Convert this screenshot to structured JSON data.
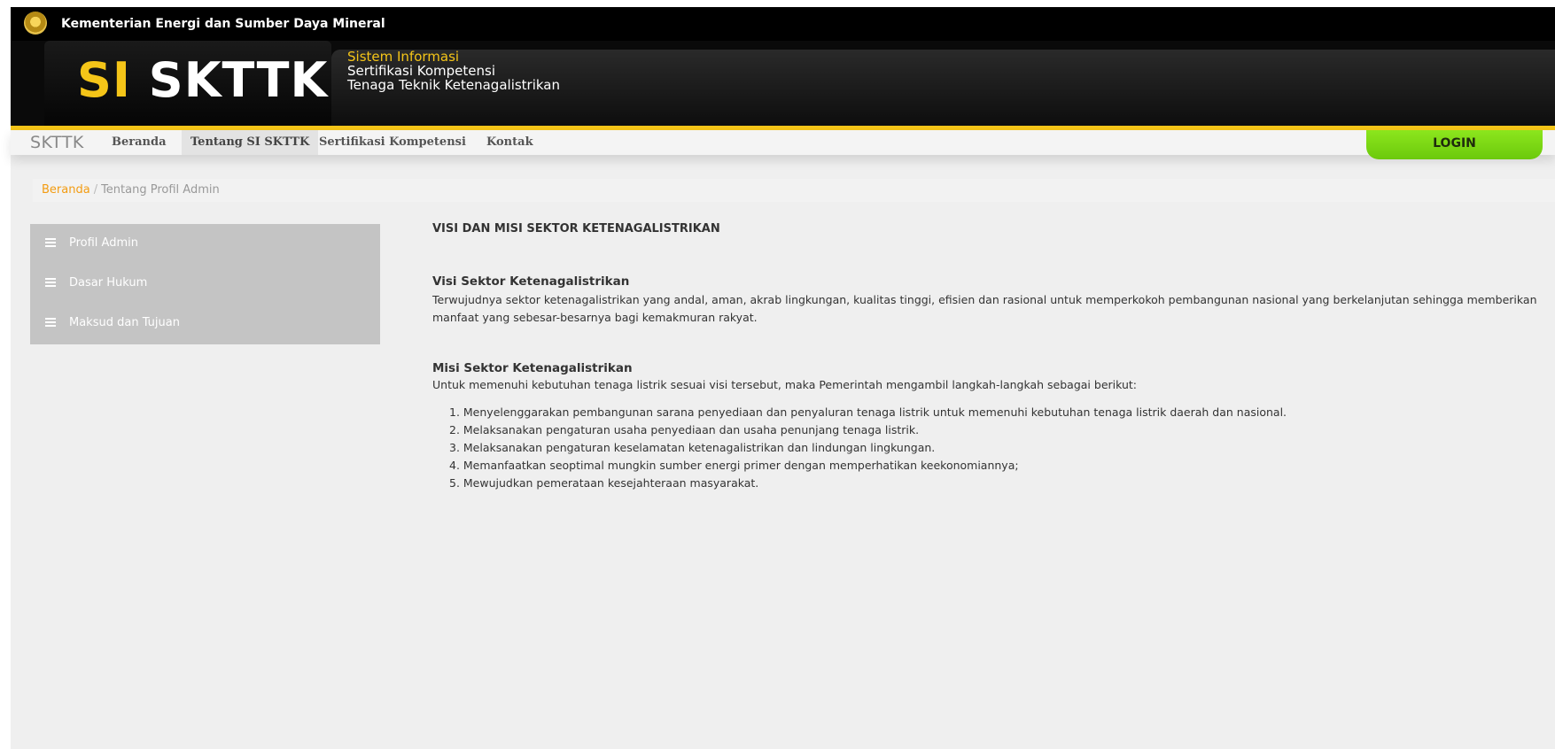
{
  "topbar": {
    "ministry_name": "Kementerian Energi dan Sumber Daya Mineral"
  },
  "banner": {
    "logo_prefix": "SI",
    "logo_main": "SKTTK",
    "tagline_line1": "Sistem Informasi",
    "tagline_line2": "Sertifikasi Kompetensi",
    "tagline_line3": "Tenaga Teknik Ketenagalistrikan"
  },
  "colors": {
    "accent": "#f5c518",
    "login": "#7bd916",
    "breadcrumb_link": "#f39c12"
  },
  "nav": {
    "brand": "SKTTK",
    "items": [
      {
        "label": "Beranda"
      },
      {
        "label": "Tentang SI SKTTK"
      },
      {
        "label": "Sertifikasi Kompetensi"
      },
      {
        "label": "Kontak"
      }
    ],
    "login_label": "LOGIN"
  },
  "breadcrumb": {
    "home": "Beranda",
    "separator": "/",
    "current": "Tentang Profil Admin"
  },
  "sidebar": {
    "items": [
      {
        "label": "Profil Admin",
        "icon": "list-icon"
      },
      {
        "label": "Dasar Hukum",
        "icon": "list-icon"
      },
      {
        "label": "Maksud dan Tujuan",
        "icon": "list-icon"
      }
    ]
  },
  "content": {
    "title": "VISI DAN MISI SEKTOR KETENAGALISTRIKAN",
    "visi_heading": "Visi Sektor Ketenagalistrikan",
    "visi_text": "Terwujudnya sektor ketenagalistrikan yang andal, aman, akrab lingkungan, kualitas tinggi, efisien dan rasional untuk memperkokoh pembangunan nasional yang berkelanjutan sehingga memberikan manfaat yang sebesar-besarnya bagi kemakmuran rakyat.",
    "misi_heading": "Misi Sektor Ketenagalistrikan",
    "misi_intro": "Untuk memenuhi kebutuhan tenaga listrik sesuai visi tersebut, maka Pemerintah mengambil langkah-langkah sebagai berikut:",
    "misi_items": [
      "1. Menyelenggarakan pembangunan sarana penyediaan dan penyaluran tenaga listrik untuk memenuhi kebutuhan tenaga listrik daerah dan nasional.",
      "2. Melaksanakan pengaturan usaha penyediaan dan usaha penunjang tenaga listrik.",
      "3. Melaksanakan pengaturan keselamatan ketenagalistrikan dan lindungan lingkungan.",
      "4. Memanfaatkan seoptimal mungkin sumber energi primer dengan memperhatikan keekonomiannya;",
      "5. Mewujudkan pemerataan kesejahteraan masyarakat."
    ]
  }
}
